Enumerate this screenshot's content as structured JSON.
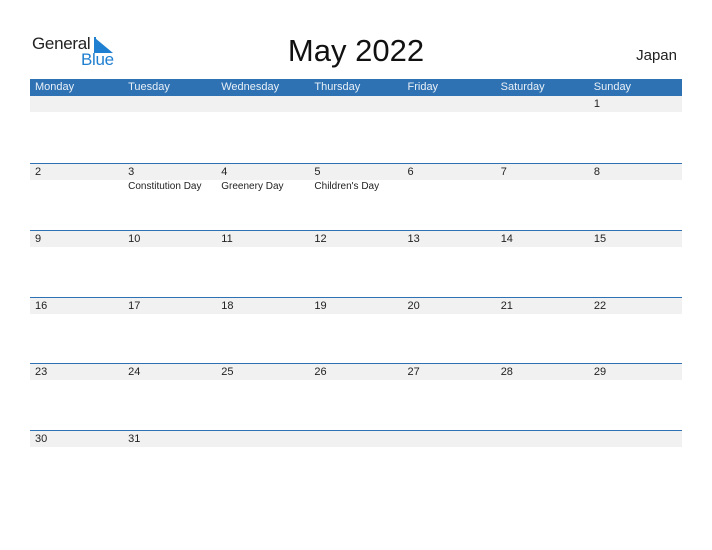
{
  "logo": {
    "word1": "General",
    "word2": "Blue"
  },
  "title": "May 2022",
  "country": "Japan",
  "colors": {
    "accent": "#2f72b3",
    "logo_blue": "#1f7fd0",
    "strip": "#f1f1f1"
  },
  "weekdays": [
    "Monday",
    "Tuesday",
    "Wednesday",
    "Thursday",
    "Friday",
    "Saturday",
    "Sunday"
  ],
  "weeks": [
    [
      {
        "d": ""
      },
      {
        "d": ""
      },
      {
        "d": ""
      },
      {
        "d": ""
      },
      {
        "d": ""
      },
      {
        "d": ""
      },
      {
        "d": "1"
      }
    ],
    [
      {
        "d": "2"
      },
      {
        "d": "3",
        "h": "Constitution Day"
      },
      {
        "d": "4",
        "h": "Greenery Day"
      },
      {
        "d": "5",
        "h": "Children's Day"
      },
      {
        "d": "6"
      },
      {
        "d": "7"
      },
      {
        "d": "8"
      }
    ],
    [
      {
        "d": "9"
      },
      {
        "d": "10"
      },
      {
        "d": "11"
      },
      {
        "d": "12"
      },
      {
        "d": "13"
      },
      {
        "d": "14"
      },
      {
        "d": "15"
      }
    ],
    [
      {
        "d": "16"
      },
      {
        "d": "17"
      },
      {
        "d": "18"
      },
      {
        "d": "19"
      },
      {
        "d": "20"
      },
      {
        "d": "21"
      },
      {
        "d": "22"
      }
    ],
    [
      {
        "d": "23"
      },
      {
        "d": "24"
      },
      {
        "d": "25"
      },
      {
        "d": "26"
      },
      {
        "d": "27"
      },
      {
        "d": "28"
      },
      {
        "d": "29"
      }
    ],
    [
      {
        "d": "30"
      },
      {
        "d": "31"
      },
      {
        "d": ""
      },
      {
        "d": ""
      },
      {
        "d": ""
      },
      {
        "d": ""
      },
      {
        "d": ""
      }
    ]
  ]
}
